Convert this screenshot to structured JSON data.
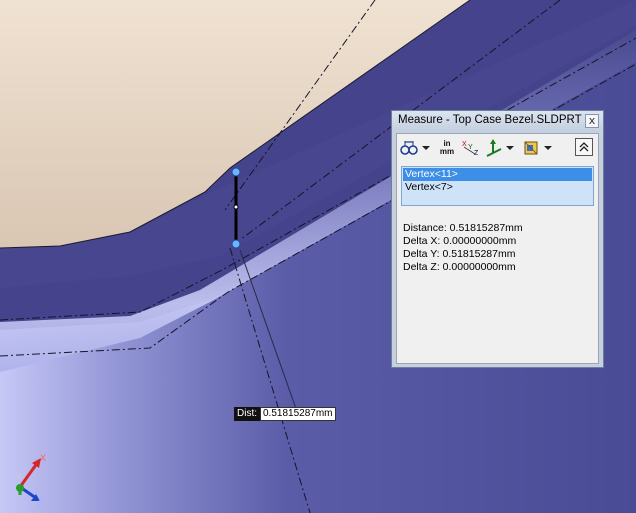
{
  "measure_window": {
    "title": "Measure - Top Case Bezel.SLDPRT",
    "close_glyph": "x",
    "toolbar": {
      "arc_options_icon": "arc-circle-options-icon",
      "units_top": "in",
      "units_bottom": "mm",
      "xyz_icon": "xyz-dimensions-icon",
      "projection_icon": "projection-axis-icon",
      "history_icon": "measurement-history-icon",
      "collapse_icon": "collapse-up-icon"
    },
    "selections": [
      "Vertex<11>",
      "Vertex<7>"
    ],
    "results": [
      "Distance: 0.51815287mm",
      "Delta X: 0.00000000mm",
      "Delta Y: 0.51815287mm",
      "Delta Z: 0.00000000mm"
    ]
  },
  "callout": {
    "key": "Dist:",
    "value": "0.51815287mm"
  },
  "triad": {
    "labels": [
      "Y",
      "X",
      "Z"
    ]
  },
  "colors": {
    "part_face": "#44438b",
    "top_face": "#e9d7c4",
    "highlight": "#cacdf6",
    "selection_blue": "#3d8ee6"
  }
}
